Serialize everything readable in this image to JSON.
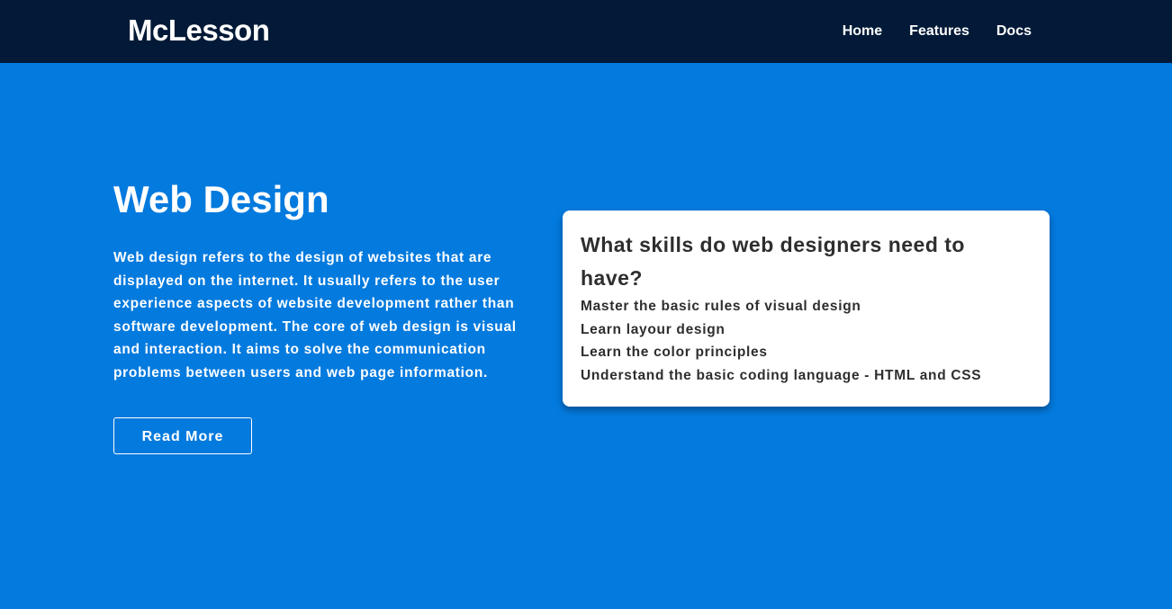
{
  "navbar": {
    "brand": "McLesson",
    "links": [
      {
        "label": "Home"
      },
      {
        "label": "Features"
      },
      {
        "label": "Docs"
      }
    ]
  },
  "hero": {
    "title": "Web Design",
    "description": "Web design refers to the design of websites that are displayed on the internet. It usually refers to the user experience aspects of website development rather than software development. The core of web design is visual and interaction. It aims to solve the communication problems between users and web page information.",
    "button_label": "Read More"
  },
  "card": {
    "title": "What skills do web designers need to have?",
    "items": [
      "Master the basic rules of visual design",
      "Learn layour design",
      "Learn the color principles",
      "Understand the basic coding language - HTML and CSS"
    ]
  },
  "colors": {
    "navbar_bg": "#021a37",
    "hero_bg": "#037ade",
    "card_bg": "#ffffff",
    "card_text": "#2e2e2e"
  }
}
